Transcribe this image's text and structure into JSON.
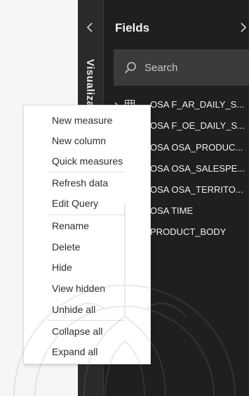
{
  "visualizations_pane": {
    "label": "Visualiza"
  },
  "fields_pane": {
    "title": "Fields",
    "search": {
      "placeholder": "Search"
    },
    "tables": [
      "OSA F_AR_DAILY_S...",
      "OSA F_OE_DAILY_S...",
      "OSA OSA_PRODUC...",
      "OSA OSA_SALESPE...",
      "OSA OSA_TERRITO...",
      "OSA TIME",
      "PRODUCT_BODY"
    ]
  },
  "context_menu": {
    "items": [
      "New measure",
      "New column",
      "Quick measures",
      "Refresh data",
      "Edit Query",
      "Rename",
      "Delete",
      "Hide",
      "View hidden",
      "Unhide all",
      "Collapse all",
      "Expand all"
    ]
  },
  "colors": {
    "dark_panel": "#1f1f1f",
    "search_box": "#3b3b3b",
    "menu_background": "#ffffff",
    "menu_text": "#2e2e2e"
  },
  "icons": [
    "chevron-left-icon",
    "chevron-right-icon",
    "search-icon",
    "table-icon",
    "chevron-right-small-icon"
  ]
}
